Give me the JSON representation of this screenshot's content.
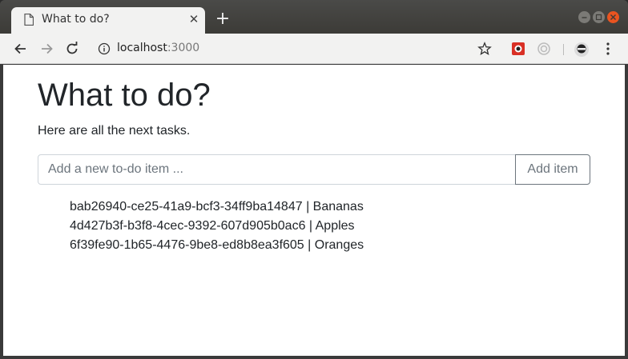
{
  "browser": {
    "tab_title": "What to do?",
    "url_host": "localhost",
    "url_port": ":3000"
  },
  "page": {
    "title": "What to do?",
    "subtitle": "Here are all the next tasks.",
    "input_placeholder": "Add a new to-do item ...",
    "add_button_label": "Add item",
    "tasks": [
      "bab26940-ce25-41a9-bcf3-34ff9ba14847 | Bananas",
      "4d427b3f-b3f8-4cec-9392-607d905b0ac6 | Apples",
      "6f39fe90-1b65-4476-9be8-ed8b8ea3f605 | Oranges"
    ]
  },
  "colors": {
    "accent_close": "#e95420",
    "text": "#212529",
    "secondary": "#6c757d"
  }
}
